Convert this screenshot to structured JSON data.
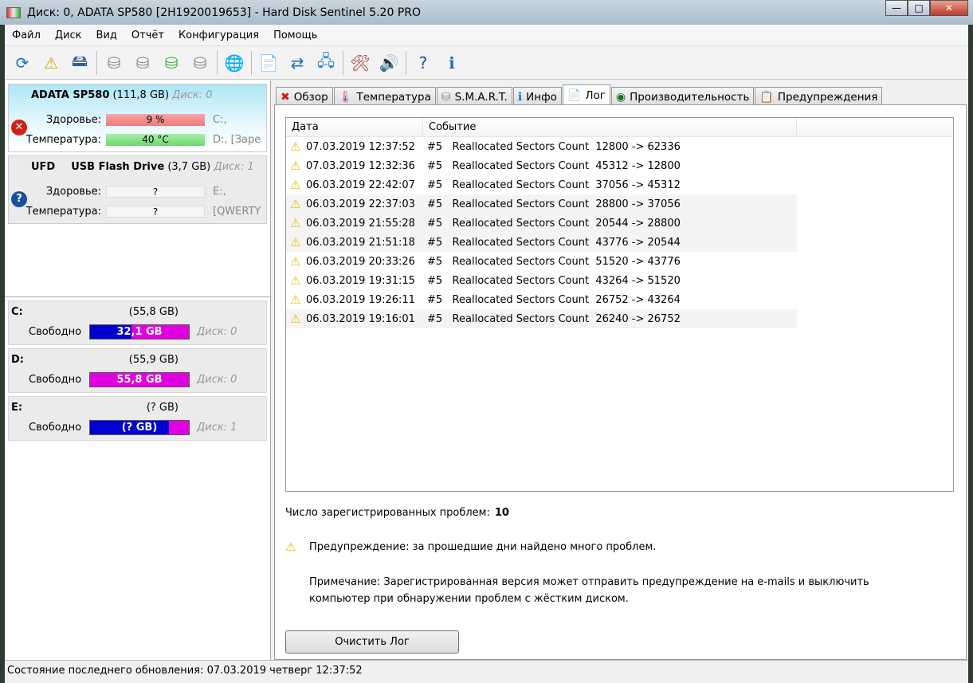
{
  "window": {
    "title": "Диск: 0, ADATA SP580 [2H1920019653]  -  Hard Disk Sentinel 5.20 PRO",
    "min": "—",
    "max": "□",
    "close": "✕"
  },
  "menu": [
    "Файл",
    "Диск",
    "Вид",
    "Отчёт",
    "Конфигурация",
    "Помощь"
  ],
  "toolbar": {
    "icons": [
      "refresh-icon",
      "alert-icon",
      "disk-icon",
      "disk-options-icon",
      "disk-info-icon",
      "disk-check-icon",
      "disk-search-icon",
      "web-icon",
      "report-icon",
      "send-icon",
      "network-icon",
      "tools-icon",
      "sound-icon",
      "help-icon",
      "info-icon"
    ],
    "glyphs": [
      "⟳",
      "⚠",
      "🖴",
      "⛁",
      "⛁",
      "⛁",
      "⛁",
      "🌐",
      "📄",
      "⇄",
      "🖧",
      "🛠",
      "🔊",
      "?",
      "ℹ"
    ]
  },
  "disks": [
    {
      "type": "",
      "name": "ADATA SP580",
      "size": "(111,8 GB)",
      "disk": "Диск: 0",
      "health_label": "Здоровье:",
      "health": "9 %",
      "temp_label": "Температура:",
      "temp": "40 °C",
      "vol1": "C:,",
      "vol2": "D:,  [Заре",
      "status": "error"
    },
    {
      "type": "UFD",
      "name": "USB Flash Drive",
      "size": "(3,7 GB)",
      "disk": "Диск: 1",
      "health_label": "Здоровье:",
      "health": "?",
      "temp_label": "Температура:",
      "temp": "?",
      "vol1": "E:,",
      "vol2": "[QWERTY",
      "status": "unknown"
    }
  ],
  "partitions": [
    {
      "letter": "C:",
      "size": "(55,8 GB)",
      "free_label": "Свободно",
      "free": "32,1 GB",
      "used_pct": 42,
      "disk": "Диск: 0"
    },
    {
      "letter": "D:",
      "size": "(55,9 GB)",
      "free_label": "Свободно",
      "free": "55,8 GB",
      "used_pct": 0,
      "disk": "Диск: 0"
    },
    {
      "letter": "E:",
      "size": "(? GB)",
      "free_label": "Свободно",
      "free": "(? GB)",
      "used_pct": 80,
      "disk": "Диск: 1"
    }
  ],
  "tabs": [
    {
      "label": "Обзор",
      "icon": "✖"
    },
    {
      "label": "Температура",
      "icon": "🌡"
    },
    {
      "label": "S.M.A.R.T.",
      "icon": "⛁"
    },
    {
      "label": "Инфо",
      "icon": "ℹ"
    },
    {
      "label": "Лог",
      "icon": "📄",
      "active": true
    },
    {
      "label": "Производительность",
      "icon": "◉"
    },
    {
      "label": "Предупреждения",
      "icon": "📋"
    }
  ],
  "log": {
    "columns": [
      "Дата",
      "Событие"
    ],
    "rows": [
      [
        "07.03.2019 12:37:52",
        "#5   Reallocated Sectors Count  12800 -> 62336"
      ],
      [
        "07.03.2019 12:32:36",
        "#5   Reallocated Sectors Count  45312 -> 12800"
      ],
      [
        "06.03.2019 22:42:07",
        "#5   Reallocated Sectors Count  37056 -> 45312"
      ],
      [
        "06.03.2019 22:37:03",
        "#5   Reallocated Sectors Count  28800 -> 37056"
      ],
      [
        "06.03.2019 21:55:28",
        "#5   Reallocated Sectors Count  20544 -> 28800"
      ],
      [
        "06.03.2019 21:51:18",
        "#5   Reallocated Sectors Count  43776 -> 20544"
      ],
      [
        "06.03.2019 20:33:26",
        "#5   Reallocated Sectors Count  51520 -> 43776"
      ],
      [
        "06.03.2019 19:31:15",
        "#5   Reallocated Sectors Count  43264 -> 51520"
      ],
      [
        "06.03.2019 19:26:11",
        "#5   Reallocated Sectors Count  26752 -> 43264"
      ],
      [
        "06.03.2019 19:16:01",
        "#5   Reallocated Sectors Count  26240 -> 26752"
      ]
    ],
    "count_label": "Число зарегистрированных проблем:",
    "count": "10",
    "warning": "Предупреждение: за прошедшие дни найдено много проблем.",
    "note": "Примечание: Зарегистрированная версия может отправить предупреждение на e-mails и выключить компьютер при обнаружении проблем с жёстким диском.",
    "clear_button": "Очистить Лог"
  },
  "statusbar": "Состояние последнего обновления: 07.03.2019 четверг 12:37:52"
}
